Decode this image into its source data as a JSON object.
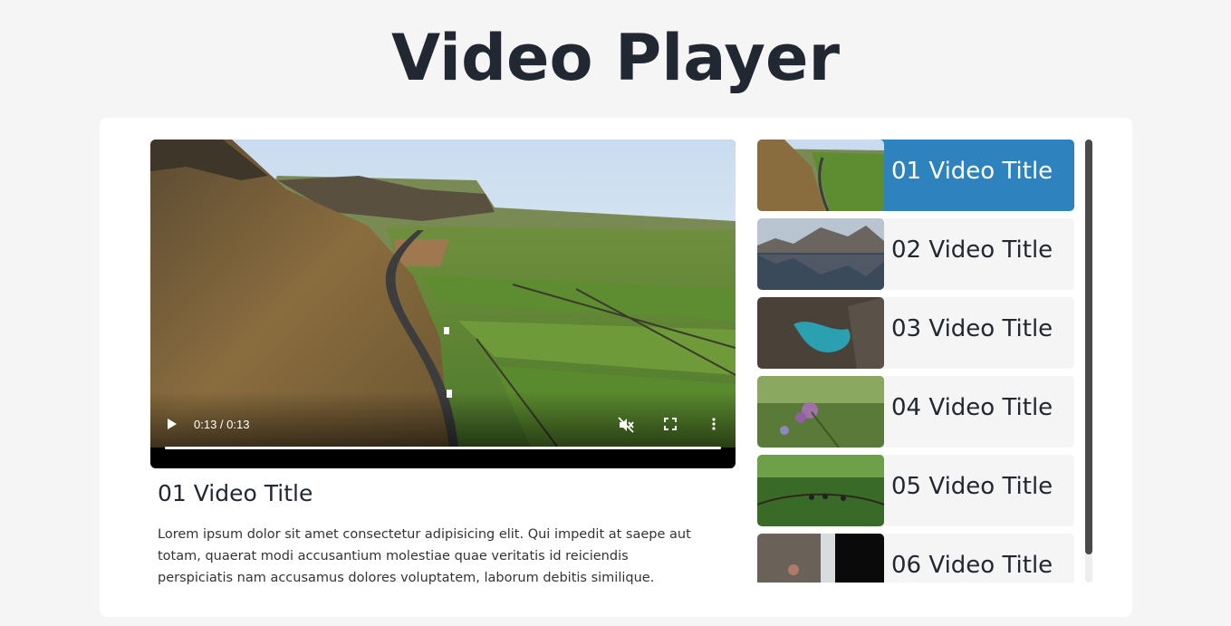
{
  "page": {
    "title": "Video Player"
  },
  "player": {
    "time": "0:13 / 0:13",
    "progress": 1.0,
    "muted": true
  },
  "current": {
    "title": "01 Video Title",
    "description": "Lorem ipsum dolor sit amet consectetur adipisicing elit. Qui impedit at saepe aut totam, quaerat modi accusantium molestiae quae veritatis id reiciendis perspiciatis nam accusamus dolores voluptatem, laborum debitis similique."
  },
  "playlist": {
    "items": [
      {
        "label": "01 Video Title",
        "active": true
      },
      {
        "label": "02 Video Title",
        "active": false
      },
      {
        "label": "03 Video Title",
        "active": false
      },
      {
        "label": "04 Video Title",
        "active": false
      },
      {
        "label": "05 Video Title",
        "active": false
      },
      {
        "label": "06 Video Title",
        "active": false
      }
    ]
  },
  "colors": {
    "accent": "#2e82bd",
    "background": "#f5f5f5",
    "text": "#222831"
  },
  "icons": [
    "play-icon",
    "mute-icon",
    "fullscreen-icon",
    "more-options-icon"
  ]
}
